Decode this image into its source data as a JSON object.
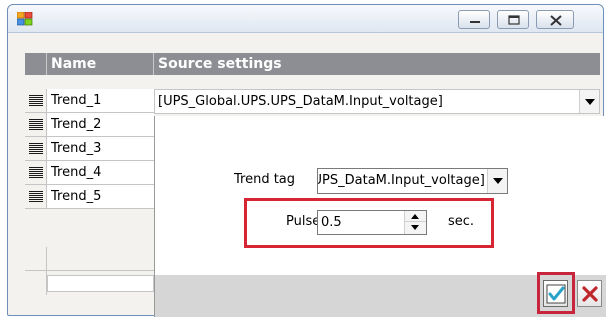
{
  "window": {
    "icon": "app-grid-icon",
    "controls": [
      "minimize-icon",
      "maximize-icon",
      "close-icon"
    ]
  },
  "grid": {
    "columns": [
      "Name",
      "Source settings"
    ],
    "rows": [
      {
        "name": "Trend_1",
        "source": "[UPS_Global.UPS.UPS_DataM.Input_voltage]"
      },
      {
        "name": "Trend_2"
      },
      {
        "name": "Trend_3"
      },
      {
        "name": "Trend_4"
      },
      {
        "name": "Trend_5"
      }
    ]
  },
  "popup": {
    "trend_tag_label": "Trend tag",
    "trend_tag_value": "[UPS_Global.UPS.UPS_DataM.Input_voltage]",
    "pulse_label": "Pulse",
    "pulse_value": "0.5",
    "pulse_unit": "sec.",
    "ok_icon": "checkmark-icon",
    "cancel_icon": "x-icon"
  },
  "colors": {
    "highlight": "#d72533",
    "header": "#8d8e94",
    "ok_check": "#2aa3c9",
    "cancel_x": "#c0272d"
  }
}
